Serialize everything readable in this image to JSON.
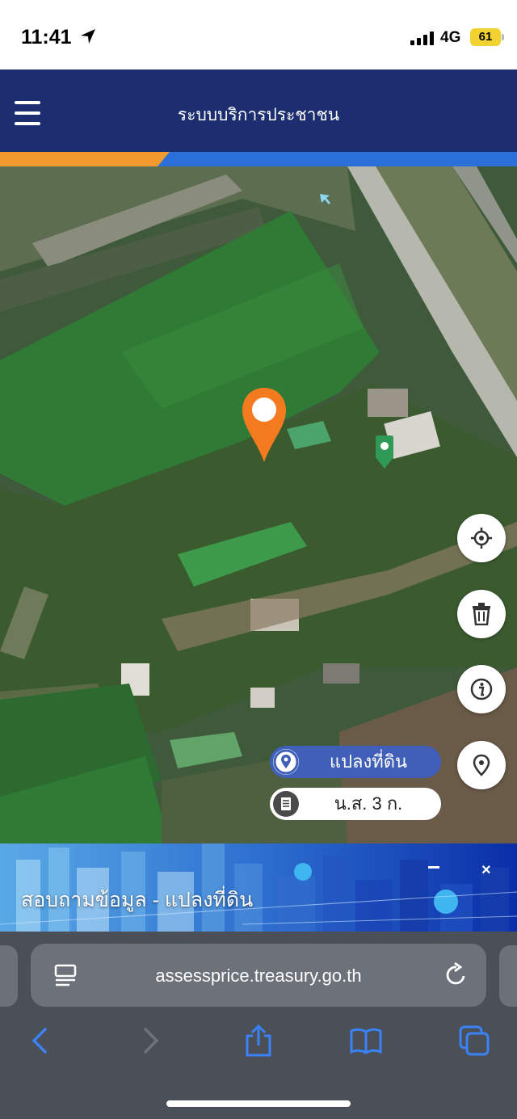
{
  "status_bar": {
    "time": "11:41",
    "network": "4G",
    "battery": "61"
  },
  "header": {
    "title": "ระบบบริการประชาชน"
  },
  "map": {
    "parcel_label": "แปลงที่ดิน",
    "document_label": "น.ส. 3 ก."
  },
  "banner": {
    "text": "สอบถามข้อมูล - แปลงที่ดิน",
    "close": "×"
  },
  "browser": {
    "url": "assessprice.treasury.go.th"
  },
  "colors": {
    "header_bg": "#1c2e70",
    "accent_orange": "#f29a2e",
    "accent_blue": "#2b6fd8",
    "marker_orange": "#f47a20",
    "marker_green": "#2e9a55",
    "pill_blue": "#3f5fb8"
  }
}
